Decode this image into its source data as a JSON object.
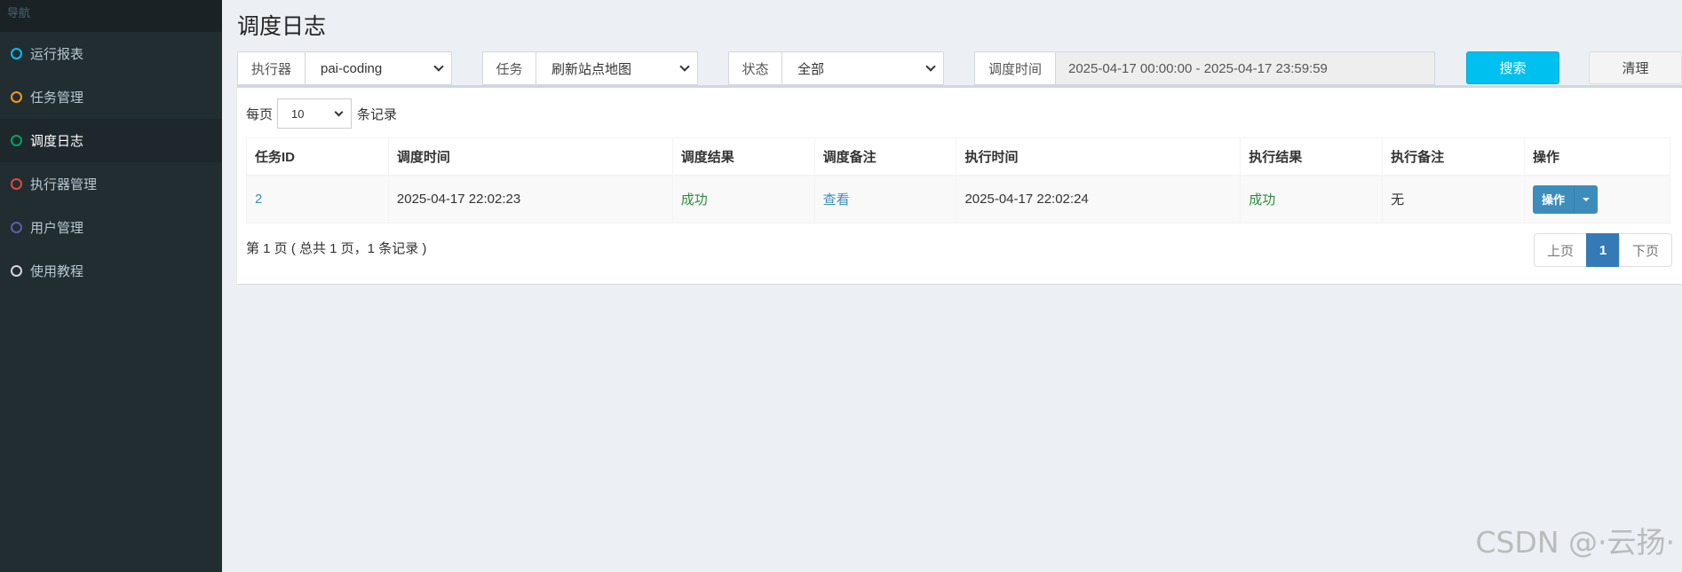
{
  "sidebar": {
    "header": "导航",
    "items": [
      {
        "label": "运行报表",
        "color": "#00c0ef"
      },
      {
        "label": "任务管理",
        "color": "#f39c12"
      },
      {
        "label": "调度日志",
        "color": "#00a65a"
      },
      {
        "label": "执行器管理",
        "color": "#dd4b39"
      },
      {
        "label": "用户管理",
        "color": "#605ca8"
      },
      {
        "label": "使用教程",
        "color": "#d2d6de"
      }
    ]
  },
  "page": {
    "title": "调度日志"
  },
  "filters": {
    "executor": {
      "label": "执行器",
      "value": "pai-coding"
    },
    "task": {
      "label": "任务",
      "value": "刷新站点地图"
    },
    "status": {
      "label": "状态",
      "value": "全部"
    },
    "time": {
      "label": "调度时间",
      "value": "2025-04-17 00:00:00 - 2025-04-17 23:59:59"
    }
  },
  "buttons": {
    "search": "搜索",
    "clear": "清理"
  },
  "pagesize": {
    "prefix": "每页",
    "value": "10",
    "suffix": "条记录"
  },
  "table": {
    "headers": [
      "任务ID",
      "调度时间",
      "调度结果",
      "调度备注",
      "执行时间",
      "执行结果",
      "执行备注",
      "操作"
    ],
    "rows": [
      {
        "id": "2",
        "trigger_time": "2025-04-17 22:02:23",
        "trigger_result": "成功",
        "trigger_note": "查看",
        "handle_time": "2025-04-17 22:02:24",
        "handle_result": "成功",
        "handle_note": "无",
        "action": "操作"
      }
    ]
  },
  "pagination": {
    "info": "第 1 页 ( 总共 1 页，1 条记录 )",
    "prev": "上页",
    "current": "1",
    "next": "下页"
  },
  "watermark": "CSDN @·云扬·"
}
